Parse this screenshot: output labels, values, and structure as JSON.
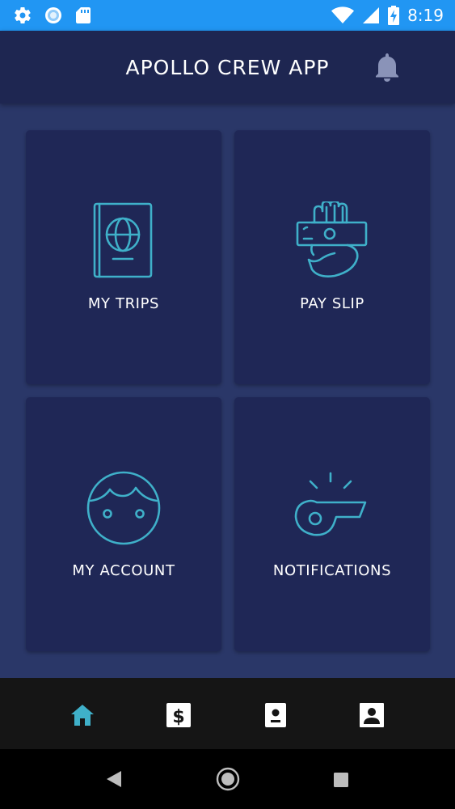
{
  "status_bar": {
    "time": "8:19",
    "left_icons": [
      "settings-icon",
      "sync-icon",
      "sd-card-icon"
    ],
    "right_icons": [
      "wifi-icon",
      "signal-icon",
      "battery-charging-icon"
    ],
    "background": "#2196f3"
  },
  "header": {
    "title": "APOLLO CREW APP",
    "notification_icon": "bell-icon",
    "background": "#1e2651"
  },
  "tiles": [
    {
      "label": "MY TRIPS",
      "icon": "passport-icon"
    },
    {
      "label": "PAY SLIP",
      "icon": "hand-money-icon"
    },
    {
      "label": "MY ACCOUNT",
      "icon": "face-icon"
    },
    {
      "label": "NOTIFICATIONS",
      "icon": "whistle-icon"
    }
  ],
  "bottom_nav": {
    "items": [
      {
        "icon": "home-icon",
        "active": true
      },
      {
        "icon": "dollar-icon",
        "active": false
      },
      {
        "icon": "id-card-icon",
        "active": false
      },
      {
        "icon": "contact-icon",
        "active": false
      }
    ],
    "active_color": "#3fb0c9",
    "inactive_color": "#ffffff"
  },
  "system_nav": [
    "back-button",
    "home-button",
    "recents-button"
  ],
  "colors": {
    "page_background": "#2a3768",
    "tile_background": "#1f2756",
    "icon_accent": "#3fb0c9"
  }
}
